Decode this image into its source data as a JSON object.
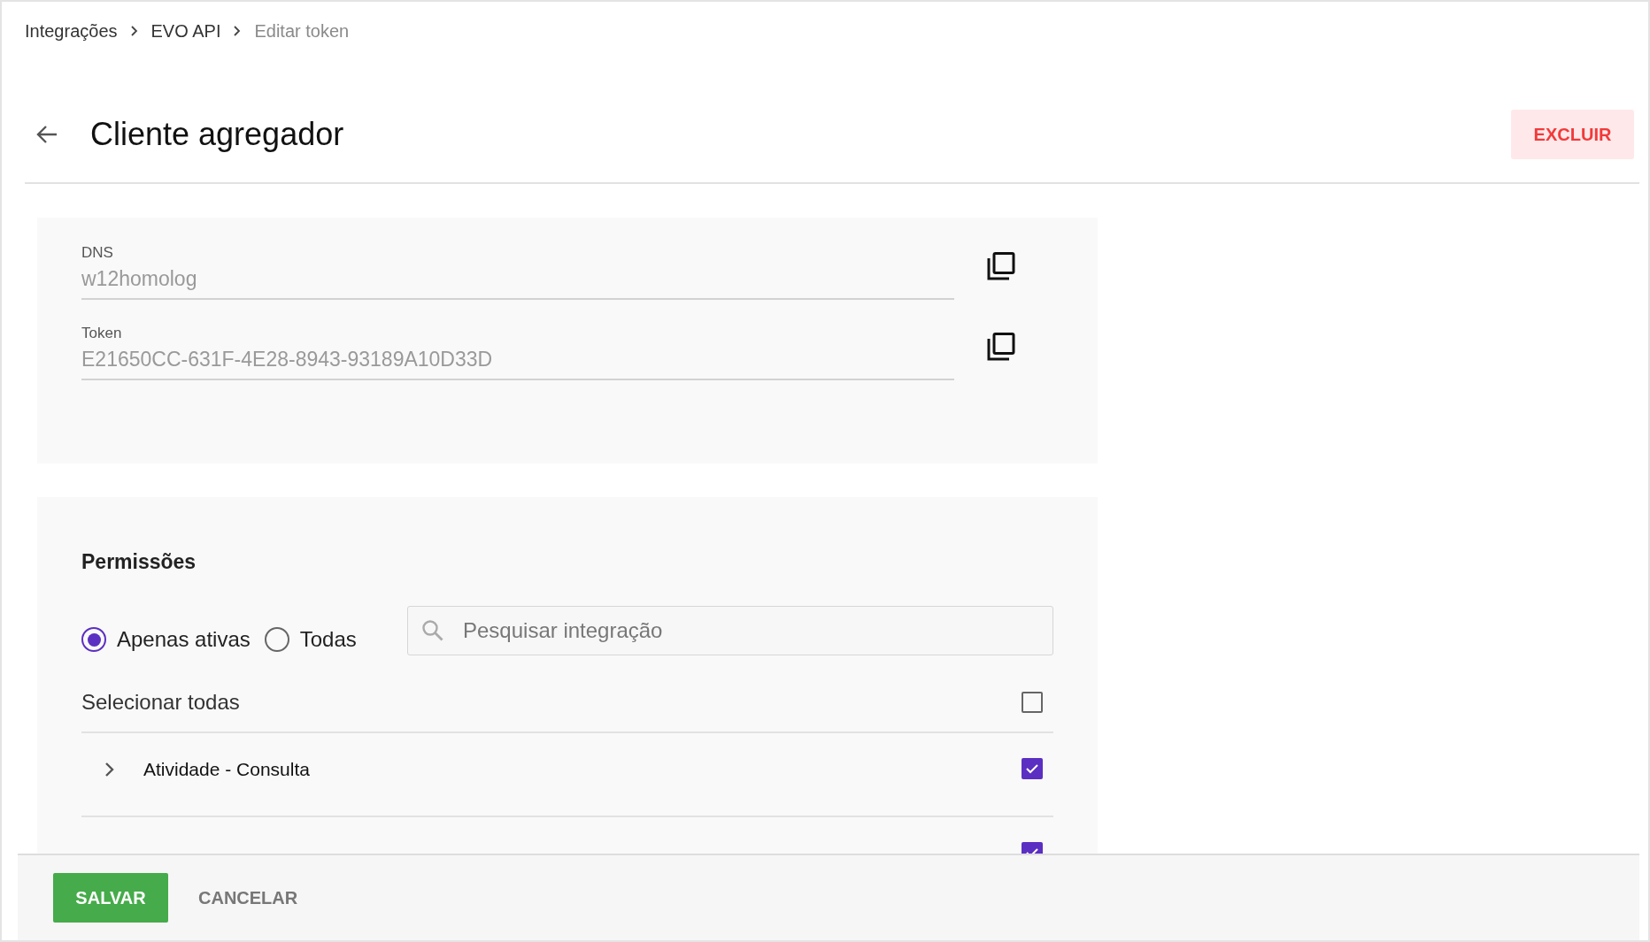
{
  "breadcrumb": [
    {
      "label": "Integrações",
      "current": false
    },
    {
      "label": "EVO API",
      "current": false
    },
    {
      "label": "Editar token",
      "current": true
    }
  ],
  "header": {
    "title": "Cliente agregador",
    "delete_button": "EXCLUIR"
  },
  "credentials": [
    {
      "label": "DNS",
      "value": "w12homolog"
    },
    {
      "label": "Token",
      "value": "E21650CC-631F-4E28-8943-93189A10D33D"
    }
  ],
  "permissions": {
    "title": "Permissões",
    "filters": [
      {
        "label": "Apenas ativas",
        "selected": true
      },
      {
        "label": "Todas",
        "selected": false
      }
    ],
    "search": {
      "placeholder": "Pesquisar integração"
    },
    "select_all": {
      "label": "Selecionar todas",
      "checked": false
    },
    "items": [
      {
        "label": "Atividade - Consulta",
        "checked": true
      },
      {
        "checked": true
      }
    ]
  },
  "footer": {
    "save_button": "SALVAR",
    "cancel_button": "CANCELAR"
  }
}
